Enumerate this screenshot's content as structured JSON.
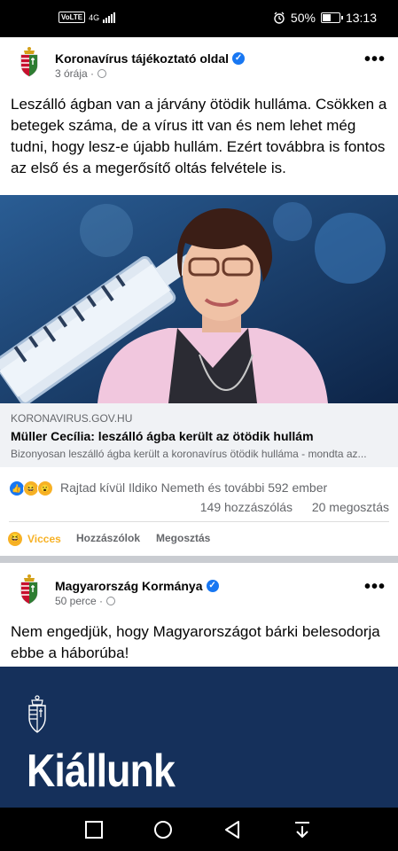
{
  "status": {
    "network": "4G",
    "volte": "VoLTE",
    "battery_pct": "50%",
    "battery_level": 0.5,
    "time": "13:13"
  },
  "posts": [
    {
      "author": "Koronavírus tájékoztató oldal",
      "time": "3 órája ·",
      "text": "Leszálló ágban van a járvány ötödik hulláma. Csökken a betegek száma, de a vírus itt van és nem lehet még tudni, hogy lesz-e újabb hullám. Ezért továbbra is fontos az első és a megerősítő oltás felvétele is.",
      "link": {
        "domain": "KORONAVIRUS.GOV.HU",
        "title": "Müller Cecília: leszálló ágba került az ötödik hullám",
        "description": "Bizonyosan leszálló ágba került a koronavírus ötödik hulláma - mondta az..."
      },
      "reactions_text": "Rajtad kívül Ildiko Nemeth és további 592 ember",
      "comments": "149 hozzászólás",
      "shares": "20 megosztás",
      "actions": {
        "reaction": "Vicces",
        "comment": "Hozzászólok",
        "share": "Megosztás"
      }
    },
    {
      "author": "Magyarország Kormánya",
      "time": "50 perce ·",
      "text": "Nem engedjük, hogy Magyarországot bárki belesodorja ebbe a háborúba!",
      "banner_text": "Kiállunk"
    }
  ],
  "colors": {
    "accent": "#1877f2",
    "vicces": "#f7b125",
    "banner_bg": "#15305b",
    "link_bg": "#f0f2f5"
  }
}
